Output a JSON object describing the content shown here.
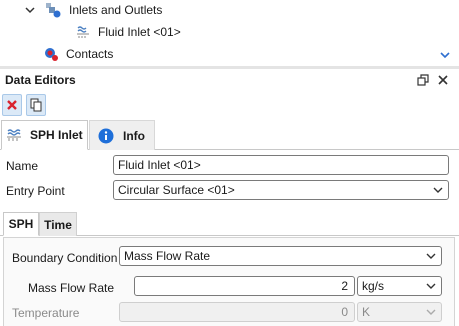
{
  "tree": {
    "items": [
      {
        "label": "Inlets and Outlets",
        "icon": "inlets-outlets-icon"
      },
      {
        "label": "Fluid Inlet <01>",
        "icon": "fluid-inlet-icon"
      },
      {
        "label": "Contacts",
        "icon": "contacts-icon"
      }
    ]
  },
  "panel": {
    "title": "Data Editors"
  },
  "tabs": [
    {
      "label": "SPH Inlet",
      "active": true
    },
    {
      "label": "Info",
      "active": false
    }
  ],
  "form": {
    "name_label": "Name",
    "name_value": "Fluid Inlet <01>",
    "entry_label": "Entry Point",
    "entry_value": "Circular Surface <01>"
  },
  "subtabs": [
    {
      "label": "SPH",
      "active": true
    },
    {
      "label": "Time",
      "active": false
    }
  ],
  "sph": {
    "boundary_label": "Boundary Condition",
    "boundary_value": "Mass Flow Rate",
    "mass_label": "Mass Flow Rate",
    "mass_value": "2",
    "mass_unit": "kg/s",
    "temp_label": "Temperature",
    "temp_value": "0",
    "temp_unit": "K"
  },
  "colors": {
    "accent": "#1e6fd9",
    "delete": "#d9232e",
    "info": "#1e6fd9"
  }
}
